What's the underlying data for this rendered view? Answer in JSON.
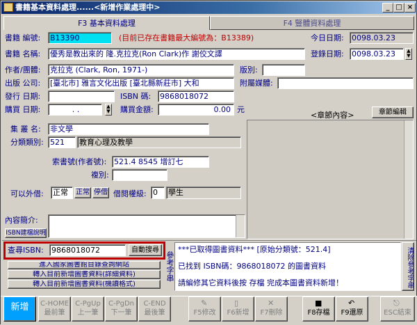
{
  "window": {
    "title": "書籍基本資料處理......<新增作業處理中>"
  },
  "title_buttons": {
    "min": "_",
    "max": "□",
    "close": "×"
  },
  "tabs": [
    {
      "label": "F3 基本資料處理"
    },
    {
      "label": "F4 豎體資料處理"
    }
  ],
  "form": {
    "book_code_label": "書籍 編號:",
    "book_code": "B13390",
    "max_code_note": "(目前已存在書籍最大編號為：B13389)",
    "today_label": "今日日期:",
    "today": "0098.03.23",
    "title_label": "書籍 名稱:",
    "title": "優秀是教出來的 隆.克拉克(Ron Clark)作 謝佼文譯",
    "register_label": "登錄日期:",
    "register_date": "0098.03.23",
    "author_label": "作者/團體:",
    "author": "克拉克 (Clark, Ron, 1971-)",
    "edition_label": "版別:",
    "edition": "",
    "publisher_label": "出版 公司:",
    "publisher": "[臺北市] 雅言文化出版 [臺北縣新莊市] 大和",
    "attachment_label": "附屬媒體:",
    "attachment": "",
    "issue_date_label": "發行 日期:",
    "issue_date": "",
    "isbn_label": "ISBN 碼:",
    "isbn": "9868018072",
    "purchase_date_label": "購買 日期:",
    "purchase_date": ".  .",
    "amount_label": "購買金額:",
    "amount": "0.00",
    "amount_unit": "元",
    "series_label": "集 叢 名:",
    "series": "非文學",
    "category_label": "分類類別:",
    "category_code": "521",
    "category_name": "教育心理及教學",
    "call_no_label": "索書號(作者號):",
    "call_no": "521.4 8545 增訂七",
    "copy_label": "複別:",
    "copy": "",
    "loan_label": "可以外借:",
    "loan_value": "正常",
    "loan_btn_normal": "正常",
    "loan_btn_stop": "停借",
    "loan_level_label": "借閱權級:",
    "loan_level": "0",
    "loan_level_name": "學生",
    "summary_label": "內容簡介:",
    "isbn_help_btn": "ISBN建檔說明",
    "chapter_label": "<章節內容>",
    "chapter_edit_btn": "章節編輯"
  },
  "isbn_search": {
    "label": "查尋ISBN:",
    "value": "9868018072",
    "auto_btn": "自動搜尋"
  },
  "links": [
    "進入國家圖書館目錄查詢網站",
    "轉入目前新增圖書資料(詳細資料)",
    "轉入目前新增圖書資料(機讀格式)"
  ],
  "ref_label": "參考字串",
  "messages": [
    "***已取得圖書資料***     [原始分類號：521.4]",
    "已找到 ISBN碼：9868018072 的圖書資料",
    "請編修其它資料後按 存檔 完成本圖書資料新增！"
  ],
  "clear_btn": "清除參考字串",
  "footer": [
    {
      "label": "新增"
    },
    {
      "label": "C-HOME 最前筆"
    },
    {
      "label": "C-PgUp 上一筆"
    },
    {
      "label": "C-PgDn 下一筆"
    },
    {
      "label": "C-END 最後筆"
    },
    {
      "label": "F5修改"
    },
    {
      "label": "F6新增"
    },
    {
      "label": "F7刪除"
    },
    {
      "label": "F8存檔"
    },
    {
      "label": "F9還原"
    },
    {
      "label": "ESC結束"
    }
  ]
}
